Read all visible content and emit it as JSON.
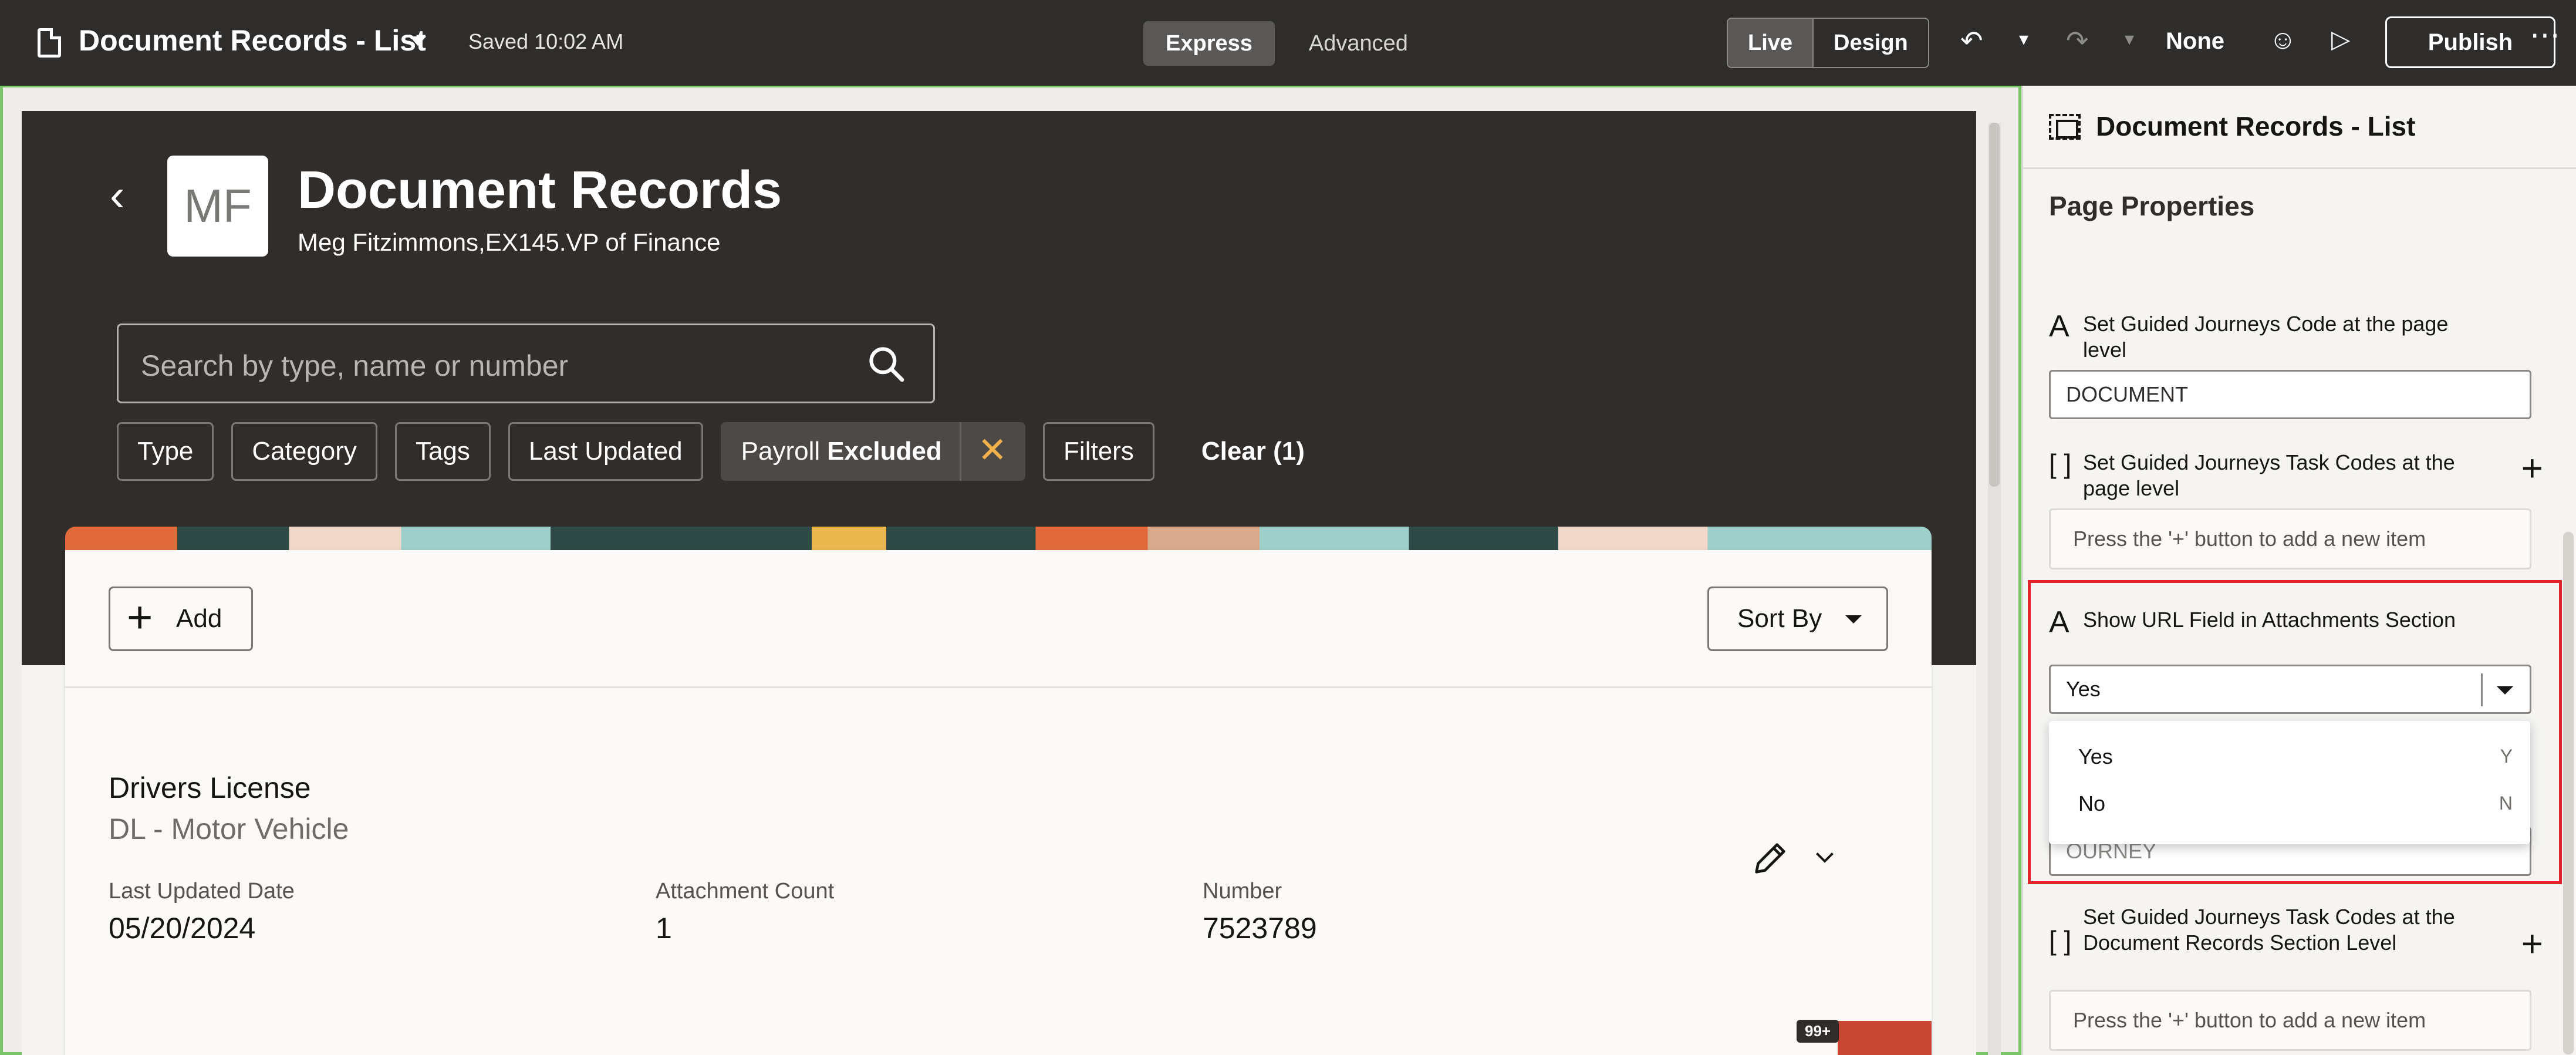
{
  "toolbar": {
    "app_title": "Document Records - List",
    "saved_status": "Saved 10:02 AM",
    "modes": [
      "Express",
      "Advanced"
    ],
    "view_modes": [
      "Live",
      "Design"
    ],
    "locale": "None",
    "publish_label": "Publish"
  },
  "page": {
    "avatar_initials": "MF",
    "title": "Document Records",
    "subtitle": "Meg Fitzimmons,EX145.VP of Finance",
    "search_placeholder": "Search by type, name or number",
    "filters": {
      "type": "Type",
      "category": "Category",
      "tags": "Tags",
      "last_updated": "Last Updated",
      "payroll_prefix": "Payroll",
      "payroll_value": "Excluded",
      "filters": "Filters",
      "clear": "Clear (1)"
    },
    "add_label": "Add",
    "sort_label": "Sort By",
    "record": {
      "title": "Drivers License",
      "subtitle": "DL - Motor Vehicle",
      "last_updated_label": "Last Updated Date",
      "last_updated_value": "05/20/2024",
      "attachment_label": "Attachment Count",
      "attachment_value": "1",
      "number_label": "Number",
      "number_value": "7523789"
    },
    "notification_count": "99+"
  },
  "panel": {
    "title": "Document Records - List",
    "section": "Page Properties",
    "gj_code_label": "Set Guided Journeys Code at the page level",
    "gj_code_value": "DOCUMENT",
    "task_codes_label": "Set Guided Journeys Task Codes at the page level",
    "add_item_hint": "Press the '+' button to add a new item",
    "url_field_label": "Show URL Field in Attachments Section",
    "url_field_value": "Yes",
    "options": [
      {
        "label": "Yes",
        "key": "Y"
      },
      {
        "label": "No",
        "key": "N"
      }
    ],
    "partial_value": "OURNEY",
    "section_task_label": "Set Guided Journeys Task Codes at the Document Records Section Level",
    "section_task_hint": "Press the '+' button to add a new item"
  },
  "colors": {
    "toolbar_bg": "#2e2d2b",
    "hero_bg": "#312d2a",
    "accent_highlight": "#e0252b",
    "canvas_border": "#7cc46a",
    "chip_close": "#f3b14a"
  }
}
